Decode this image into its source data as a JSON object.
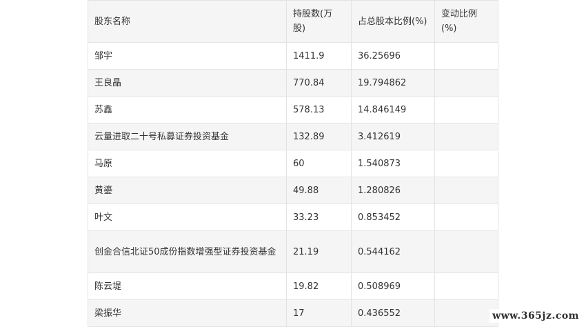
{
  "table": {
    "headers": {
      "name": "股东名称",
      "shares": "持股数(万股)",
      "ratio": "占总股本比例(%)",
      "change": "变动比例(%)"
    },
    "rows": [
      {
        "name": "邹宇",
        "shares": "1411.9",
        "ratio": "36.25696",
        "change": ""
      },
      {
        "name": "王良晶",
        "shares": "770.84",
        "ratio": "19.794862",
        "change": ""
      },
      {
        "name": "苏鑫",
        "shares": "578.13",
        "ratio": "14.846149",
        "change": ""
      },
      {
        "name": "云量进取二十号私募证券投资基金",
        "shares": "132.89",
        "ratio": "3.412619",
        "change": ""
      },
      {
        "name": "马原",
        "shares": "60",
        "ratio": "1.540873",
        "change": ""
      },
      {
        "name": "黄鎏",
        "shares": "49.88",
        "ratio": "1.280826",
        "change": ""
      },
      {
        "name": "叶文",
        "shares": "33.23",
        "ratio": "0.853452",
        "change": ""
      },
      {
        "name": "创金合信北证50成份指数增强型证券投资基金",
        "shares": "21.19",
        "ratio": "0.544162",
        "change": ""
      },
      {
        "name": "陈云堤",
        "shares": "19.82",
        "ratio": "0.508969",
        "change": ""
      },
      {
        "name": "梁振华",
        "shares": "17",
        "ratio": "0.436552",
        "change": ""
      }
    ]
  },
  "watermark": "www.365jz.com"
}
